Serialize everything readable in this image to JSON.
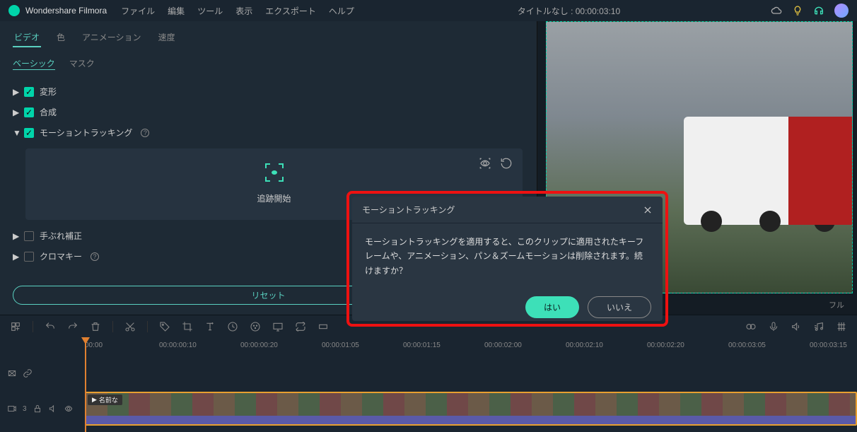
{
  "header": {
    "app_name": "Wondershare Filmora",
    "menu": [
      "ファイル",
      "編集",
      "ツール",
      "表示",
      "エクスポート",
      "ヘルプ"
    ],
    "title": "タイトルなし : 00:00:03:10"
  },
  "panel": {
    "tabs": [
      "ビデオ",
      "色",
      "アニメーション",
      "速度"
    ],
    "subtabs": [
      "ベーシック",
      "マスク"
    ],
    "sections": {
      "transform": "変形",
      "compose": "合成",
      "motion_tracking": "モーショントラッキング",
      "track_btn": "追跡開始",
      "stabilize": "手ぶれ補正",
      "chroma": "クロマキー"
    },
    "reset": "リセット"
  },
  "dialog": {
    "title": "モーショントラッキング",
    "body": "モーショントラッキングを適用すると、このクリップに適用されたキーフレームや、アニメーション、パン＆ズームモーションは削除されます。続けますか？",
    "yes": "はい",
    "no": "いいえ"
  },
  "preview": {
    "full_label": "フル"
  },
  "timeline": {
    "ticks": [
      "00:00",
      "00:00:00:10",
      "00:00:00:20",
      "00:00:01:05",
      "00:00:01:15",
      "00:00:02:00",
      "00:00:02:10",
      "00:00:02:20",
      "00:00:03:05",
      "00:00:03:15"
    ],
    "clip_name": "名前な",
    "track_count": "3"
  }
}
